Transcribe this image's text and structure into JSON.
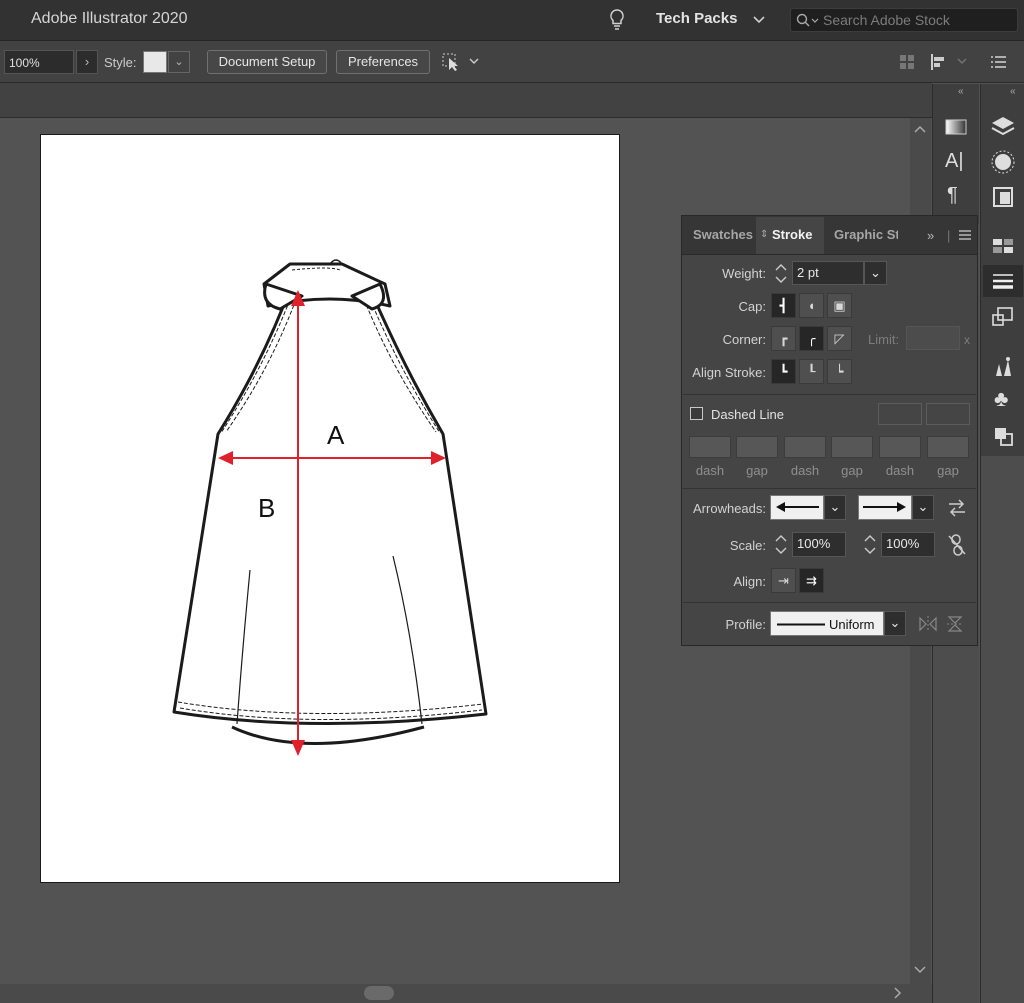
{
  "app": {
    "title": "Adobe Illustrator 2020",
    "workspace": "Tech Packs",
    "search_placeholder": "Search Adobe Stock"
  },
  "control_bar": {
    "zoom": "100%",
    "style_label": "Style:",
    "document_setup": "Document Setup",
    "preferences": "Preferences"
  },
  "artboard": {
    "label_a": "A",
    "label_b": "B",
    "guide_color": "#e0202a"
  },
  "stroke_panel": {
    "tabs": [
      "Swatches",
      "Stroke",
      "Graphic St"
    ],
    "weight_label": "Weight:",
    "weight_value": "2 pt",
    "cap_label": "Cap:",
    "corner_label": "Corner:",
    "limit_label": "Limit:",
    "limit_unit": "x",
    "align_stroke_label": "Align Stroke:",
    "dashed_line_label": "Dashed Line",
    "dash_labels": [
      "dash",
      "gap",
      "dash",
      "gap",
      "dash",
      "gap"
    ],
    "arrowheads_label": "Arrowheads:",
    "scale_label": "Scale:",
    "scale_start": "100%",
    "scale_end": "100%",
    "align_label": "Align:",
    "profile_label": "Profile:",
    "profile_value": "Uniform"
  },
  "icons": [
    "lightbulb-icon",
    "search-icon",
    "layers-icon",
    "gradient-icon",
    "character-icon",
    "paragraph-icon"
  ]
}
